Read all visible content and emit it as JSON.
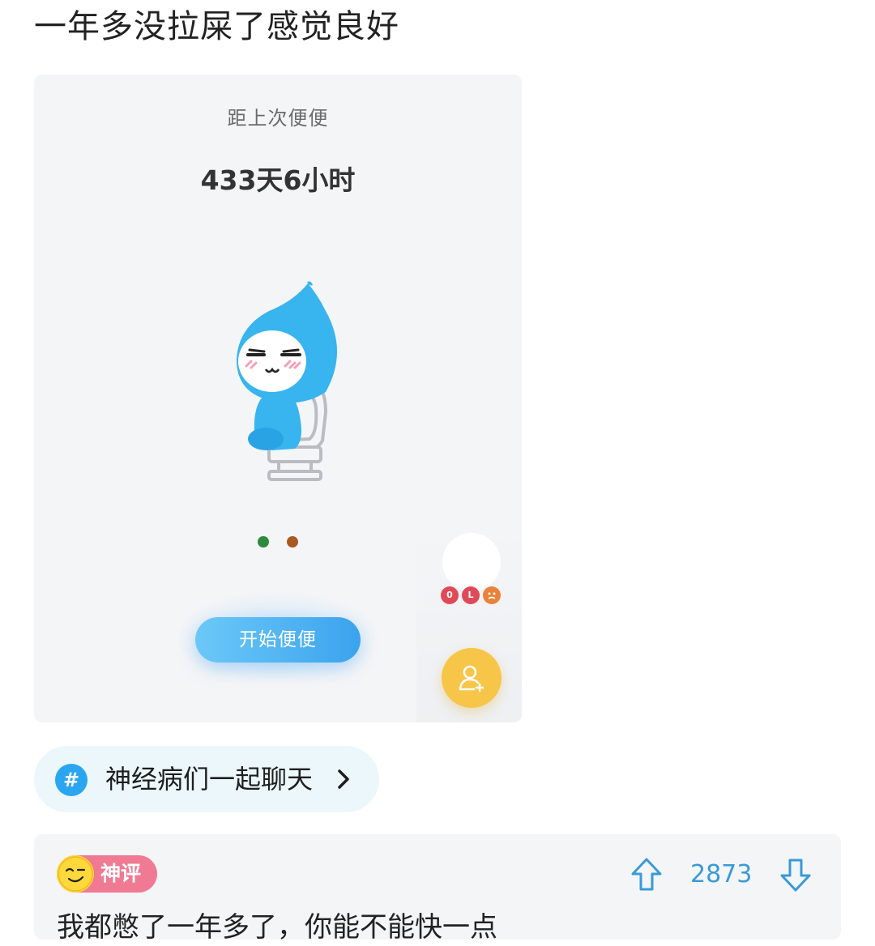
{
  "post": {
    "title": "一年多没拉屎了感觉良好"
  },
  "screenshot": {
    "label": "距上次便便",
    "duration": "433天6小时",
    "start_button": "开始便便",
    "badges": [
      "0",
      "L",
      ""
    ]
  },
  "topic": {
    "icon": "#",
    "label": "神经病们一起聊天"
  },
  "comment": {
    "badge_label": "神评",
    "vote_count": "2873",
    "text": "我都憋了一年多了，你能不能快一点"
  },
  "colors": {
    "accent_blue": "#3ba3ee",
    "fab_yellow": "#f7c548",
    "hot_pink": "#f07a93",
    "vote_blue": "#3a9ad6"
  }
}
